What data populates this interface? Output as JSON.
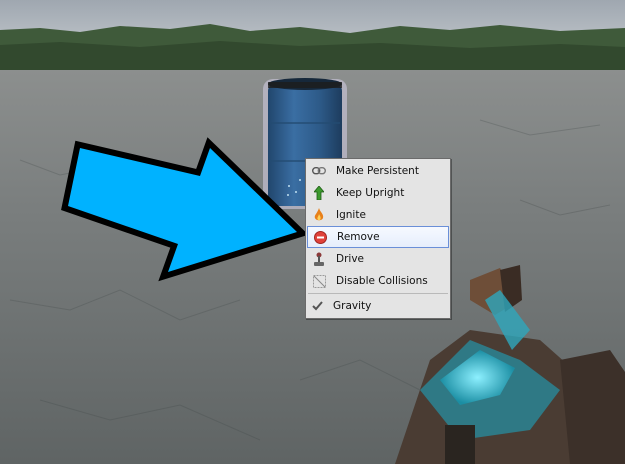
{
  "context_menu": {
    "items": [
      {
        "label": "Make Persistent",
        "icon": "link-icon"
      },
      {
        "label": "Keep Upright",
        "icon": "up-arrow-icon"
      },
      {
        "label": "Ignite",
        "icon": "flame-icon"
      },
      {
        "label": "Remove",
        "icon": "remove-icon",
        "selected": true
      },
      {
        "label": "Drive",
        "icon": "joystick-icon"
      },
      {
        "label": "Disable Collisions",
        "icon": "collision-icon"
      },
      {
        "label": "Gravity",
        "icon": "checkmark-icon",
        "checked": true
      }
    ]
  },
  "colors": {
    "arrow_fill": "#00b2ff",
    "barrel": "#2f5f90",
    "menu_bg": "#e4e4e4",
    "menu_highlight_border": "#6a8fd8"
  }
}
